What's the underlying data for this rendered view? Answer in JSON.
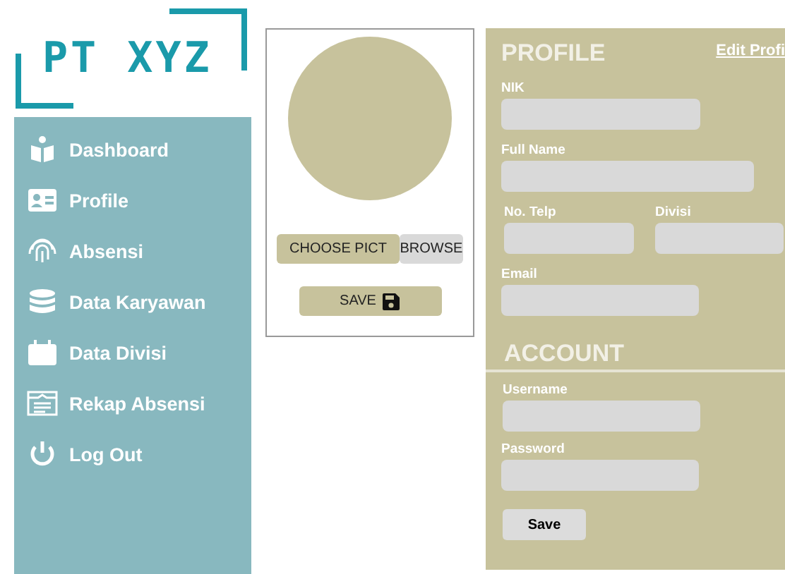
{
  "logo": {
    "text": "PT XYZ"
  },
  "sidebar": {
    "items": [
      {
        "label": "Dashboard"
      },
      {
        "label": "Profile"
      },
      {
        "label": "Absensi"
      },
      {
        "label": "Data Karyawan"
      },
      {
        "label": "Data Divisi"
      },
      {
        "label": "Rekap Absensi"
      },
      {
        "label": "Log Out"
      }
    ]
  },
  "photo": {
    "choose_button": "CHOOSE PICT",
    "browse_button": "BROWSE",
    "save_button": "SAVE"
  },
  "profile": {
    "title": "PROFILE",
    "edit_link": "Edit Profi",
    "nik_label": "NIK",
    "fullname_label": "Full Name",
    "telp_label": "No. Telp",
    "divisi_label": "Divisi",
    "email_label": "Email"
  },
  "account": {
    "title": "ACCOUNT",
    "username_label": "Username",
    "password_label": "Password",
    "save_button": "Save"
  }
}
